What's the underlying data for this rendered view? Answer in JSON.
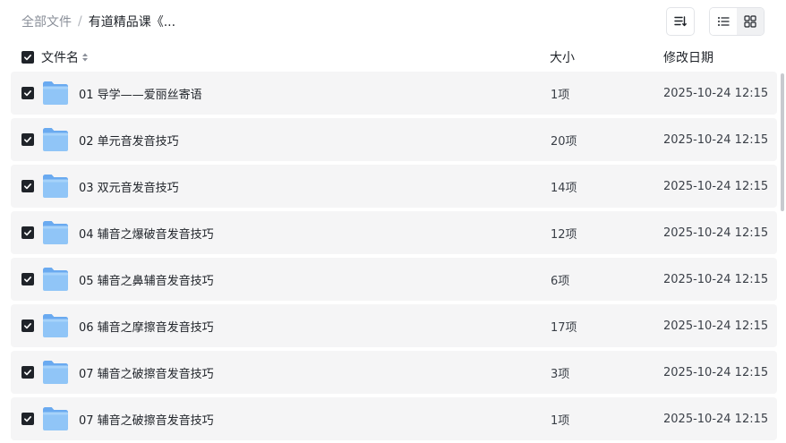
{
  "breadcrumb": {
    "root": "全部文件",
    "separator": "/",
    "current": "有道精品课《..."
  },
  "toolbar": {
    "sort_icon": "sort-lines-icon",
    "list_view_icon": "list-view-icon",
    "grid_view_icon": "grid-view-icon",
    "active_view": "list"
  },
  "header": {
    "name": "文件名",
    "size": "大小",
    "mtime": "修改日期"
  },
  "colors": {
    "checkbox": "#1f2329",
    "row_bg": "#f5f5f6",
    "folder": "#7fb9f2"
  },
  "files": [
    {
      "name": "01 导学——爱丽丝寄语",
      "size": "1项",
      "mtime": "2025-10-24 12:15",
      "checked": true
    },
    {
      "name": "02 单元音发音技巧",
      "size": "20项",
      "mtime": "2025-10-24 12:15",
      "checked": true
    },
    {
      "name": "03 双元音发音技巧",
      "size": "14项",
      "mtime": "2025-10-24 12:15",
      "checked": true
    },
    {
      "name": "04 辅音之爆破音发音技巧",
      "size": "12项",
      "mtime": "2025-10-24 12:15",
      "checked": true
    },
    {
      "name": "05 辅音之鼻辅音发音技巧",
      "size": "6项",
      "mtime": "2025-10-24 12:15",
      "checked": true
    },
    {
      "name": "06 辅音之摩擦音发音技巧",
      "size": "17项",
      "mtime": "2025-10-24 12:15",
      "checked": true
    },
    {
      "name": "07 辅音之破擦音发音技巧",
      "size": "3项",
      "mtime": "2025-10-24 12:15",
      "checked": true
    },
    {
      "name": "07 辅音之破擦音发音技巧",
      "size": "1项",
      "mtime": "2025-10-24 12:15",
      "checked": true
    }
  ]
}
